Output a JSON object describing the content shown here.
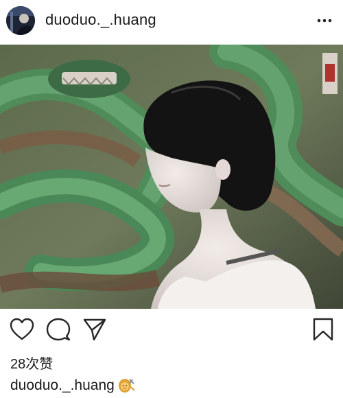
{
  "post": {
    "username": "duoduo._.huang",
    "likes_text": "28次赞",
    "caption_username": "duoduo._.huang",
    "caption_emoji": "hairdresser-emoji"
  },
  "icons": {
    "more": "more-icon",
    "like": "heart-icon",
    "comment": "comment-icon",
    "share": "send-icon",
    "save": "bookmark-icon"
  },
  "colors": {
    "text": "#1a1a1a",
    "icon": "#262626",
    "background": "#ffffff"
  }
}
